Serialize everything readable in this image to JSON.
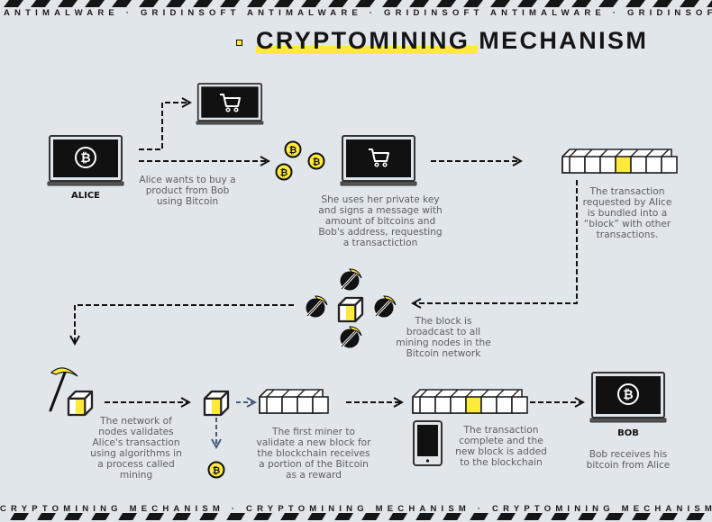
{
  "banner": {
    "top_text": "ANTIMALWARE · GRIDINSOFT ANTIMALWARE · GRIDINSOFT ANTIMALWARE · GRIDINSOFT ANTIMALWARE",
    "bottom_text": "CRYPTOMINING MECHANISM · CRYPTOMINING MECHANISM · CRYPTOMINING MECHANISM · CRYPTOMINING MECHANISM"
  },
  "title": "CRYPTOMINING MECHANISM",
  "colors": {
    "background": "#e1e6ea",
    "accent_yellow": "#ffe93a",
    "ink": "#111111",
    "caption_gray": "#5c5f63",
    "reward_arrow": "#4a5d78"
  },
  "actors": {
    "alice": "ALICE",
    "bob": "BOB"
  },
  "steps": [
    {
      "id": "step-1",
      "caption": [
        "Alice wants to buy a",
        "product from Bob",
        "using Bitcoin"
      ]
    },
    {
      "id": "step-2",
      "caption": [
        "She uses her private key",
        "and signs a message with",
        "amount of bitcoins and",
        "Bob's address, requesting",
        "a transactiction"
      ]
    },
    {
      "id": "step-3",
      "caption": [
        "The transaction",
        "requested by Alice",
        "is bundled into a",
        "“block” with other",
        "transactions."
      ]
    },
    {
      "id": "step-4",
      "caption": [
        "The block is",
        "broadcast to all",
        "mining nodes in the",
        "Bitcoin network"
      ]
    },
    {
      "id": "step-5",
      "caption": [
        "The network of",
        "nodes validates",
        "Alice's transaction",
        "using algorithms in",
        "a process called",
        "mining"
      ]
    },
    {
      "id": "step-6",
      "caption": [
        "The first miner to",
        "validate a new block for",
        "the blockchain receives",
        "a portion of the Bitcoin",
        "as a reward"
      ]
    },
    {
      "id": "step-7",
      "caption": [
        "The transaction",
        "complete and the",
        "new block is added",
        "to the blockchain"
      ]
    },
    {
      "id": "step-8",
      "caption": [
        "Bob receives his",
        "bitcoin from Alice"
      ]
    }
  ],
  "icons": {
    "laptop_bitcoin": "laptop-bitcoin-icon",
    "laptop_cart": "laptop-cart-icon",
    "coin": "bitcoin-coin-icon",
    "block": "block-cube-icon",
    "chain": "blockchain-icon",
    "miner": "pickaxe-node-icon",
    "pickaxe": "pickaxe-icon",
    "phone": "smartphone-icon"
  },
  "blockchain": {
    "pending_chain_blocks": 7,
    "pending_highlight_index": 3,
    "reward_chain_blocks": 4,
    "final_chain_blocks": 7,
    "final_highlight_index": 3
  }
}
